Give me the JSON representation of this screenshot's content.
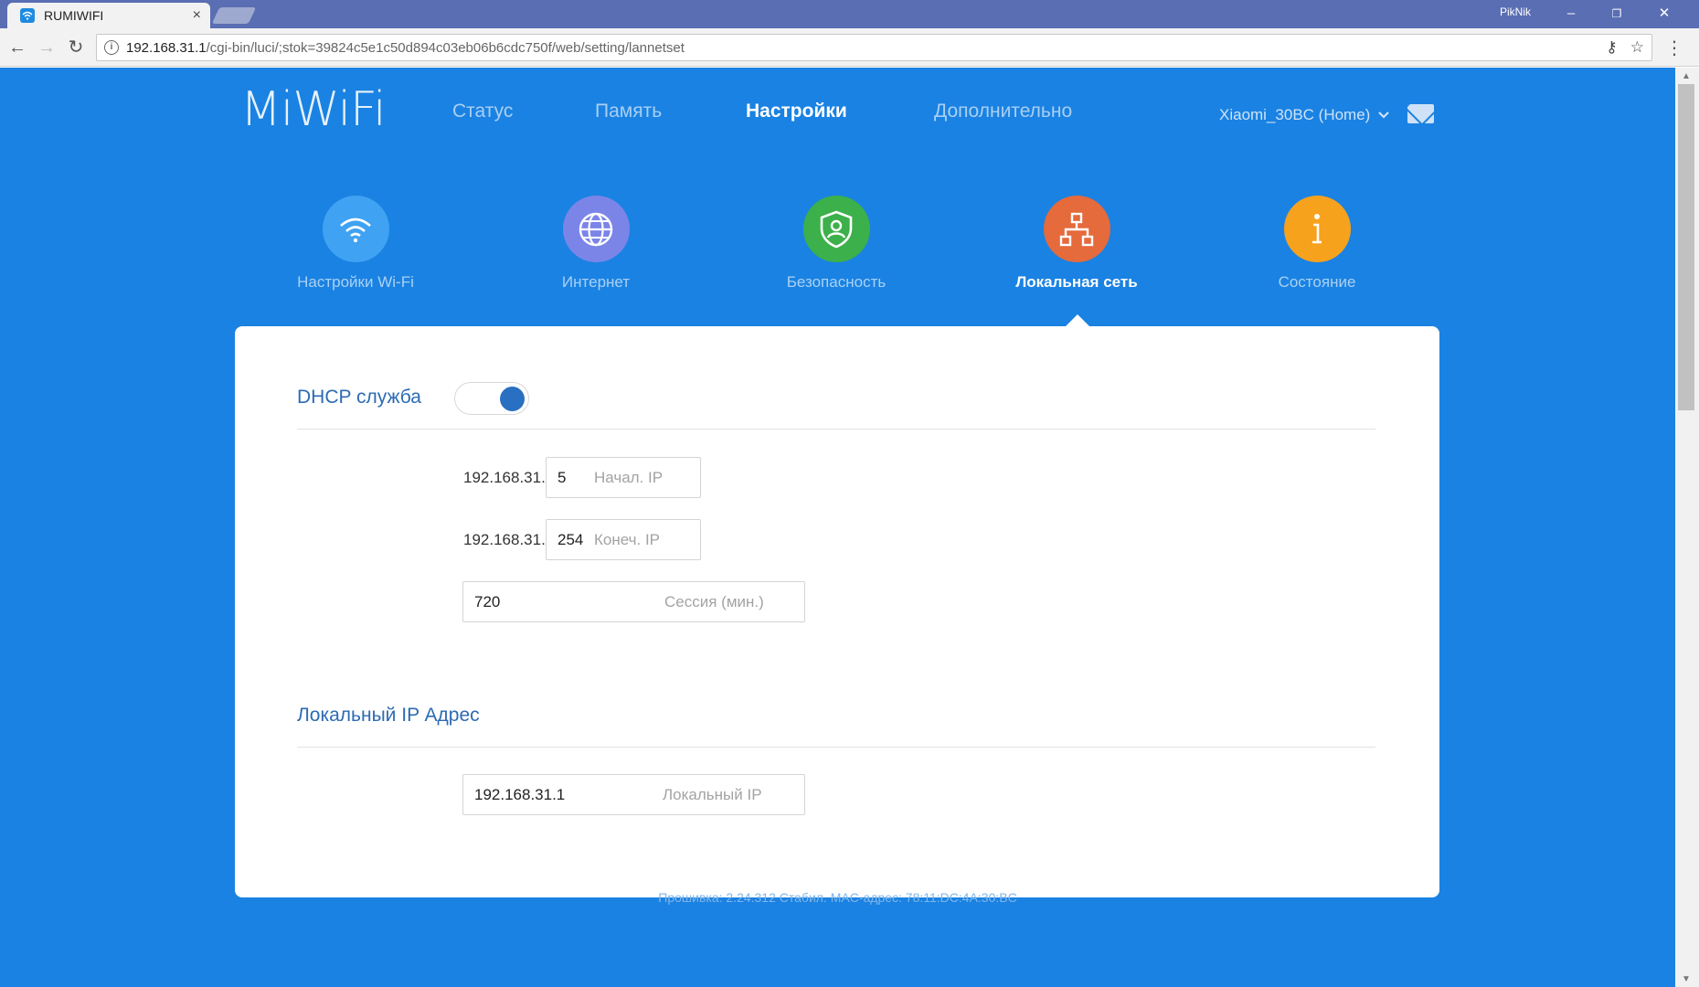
{
  "browser": {
    "tab_title": "RUMIWIFI",
    "tab_close": "×",
    "user": "PikNik",
    "minimize": "–",
    "restore": "❐",
    "close": "✕",
    "url_host": "192.168.31.1",
    "url_path": "/cgi-bin/luci/;stok=39824c5e1c50d894c03eb06b6cdc750f/web/setting/lannetset"
  },
  "header": {
    "logo": "MiWiFi",
    "nav": [
      "Статус",
      "Память",
      "Настройки",
      "Дополнительно"
    ],
    "active_nav": "Настройки",
    "device": "Xiaomi_30BC (Home)"
  },
  "categories": [
    {
      "label": "Настройки Wi-Fi",
      "icon": "wifi-icon",
      "color": "#3fa2f2"
    },
    {
      "label": "Интернет",
      "icon": "globe-icon",
      "color": "#7b85e8"
    },
    {
      "label": "Безопасность",
      "icon": "shield-icon",
      "color": "#3cb04a"
    },
    {
      "label": "Локальная сеть",
      "icon": "network-icon",
      "color": "#e56a3c"
    },
    {
      "label": "Состояние",
      "icon": "info-icon",
      "color": "#f6a21d"
    }
  ],
  "active_category": "Локальная сеть",
  "dhcp": {
    "title": "DHCP служба",
    "enabled": true,
    "prefix1": "192.168.31.",
    "start_value": "5",
    "start_placeholder": "Начал. IP",
    "prefix2": "192.168.31.",
    "end_value": "254",
    "end_placeholder": "Конеч. IP",
    "lease_value": "720",
    "lease_placeholder": "Сессия (мин.)"
  },
  "lan": {
    "title": "Локальный IP Адрес",
    "ip_value": "192.168.31.1",
    "ip_placeholder": "Локальный IP"
  },
  "footer": {
    "text": "Прошивка: 2.24.312 Стабил.  MAC-адрес: 78:11:DC:4A:30:BC"
  }
}
